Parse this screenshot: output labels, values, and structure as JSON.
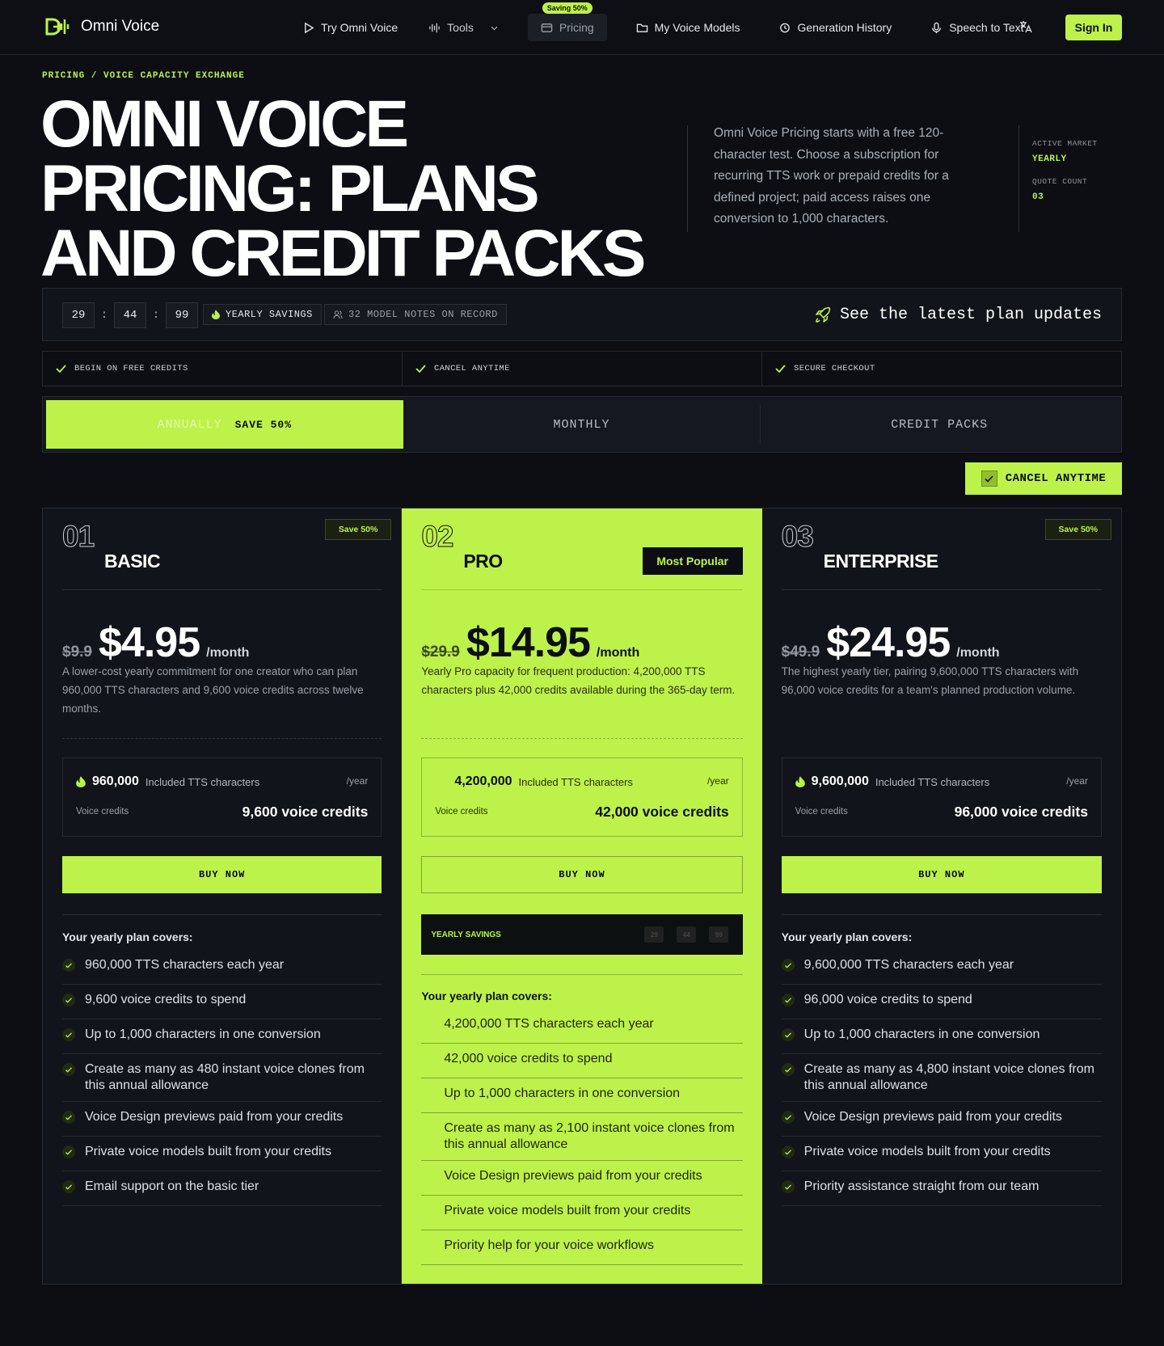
{
  "nav": {
    "logo_text": "Omni Voice",
    "items": [
      {
        "label": "Try Omni Voice",
        "icon": "play-icon"
      },
      {
        "label": "Tools",
        "icon": "waveform-icon"
      },
      {
        "label": "Pricing",
        "icon": "card-icon",
        "badge": "Saving 50%"
      },
      {
        "label": "My Voice Models",
        "icon": "folder-icon"
      },
      {
        "label": "Generation History",
        "icon": "history-icon"
      },
      {
        "label": "Speech to Text",
        "icon": "mic-icon"
      }
    ],
    "signin": "Sign In"
  },
  "hero": {
    "breadcrumb": "PRICING / VOICE CAPACITY EXCHANGE",
    "title": "OMNI VOICE PRICING: PLANS AND CREDIT PACKS",
    "description": "Omni Voice Pricing starts with a free 120-character test. Choose a subscription for recurring TTS work or prepaid credits for a defined project; paid access raises one conversion to 1,000 characters.",
    "market_label": "ACTIVE MARKET",
    "market_value": "YEARLY",
    "quote_label": "QUOTE COUNT",
    "quote_value": "03"
  },
  "stats": {
    "timer": [
      "29",
      "44",
      "99"
    ],
    "savings": "YEARLY SAVINGS",
    "notes": "32 MODEL NOTES ON RECORD",
    "latest": "See the latest plan updates"
  },
  "benefits": [
    "BEGIN ON FREE CREDITS",
    "CANCEL ANYTIME",
    "SECURE CHECKOUT"
  ],
  "tabs": {
    "annually": "ANNUALLY",
    "annually_save": "SAVE 50%",
    "monthly": "MONTHLY",
    "credit": "CREDIT PACKS"
  },
  "cancel_anytime": "CANCEL ANYTIME",
  "plans": [
    {
      "num": "01",
      "name": "BASIC",
      "save": "Save 50%",
      "old": "$9.9",
      "price": "$4.95",
      "per": "/month",
      "desc": "A lower-cost yearly commitment for one creator who can plan 960,000 TTS characters and 9,600 voice credits across twelve months.",
      "tts": "960,000",
      "tts_label": "Included TTS characters",
      "year": "/year",
      "vc_label": "Voice credits",
      "vc": "9,600 voice credits",
      "buy": "BUY NOW",
      "covers": "Your yearly plan covers:",
      "features": [
        "960,000 TTS characters each year",
        "9,600 voice credits to spend",
        "Up to 1,000 characters in one conversion",
        "Create as many as 480 instant voice clones from this annual allowance",
        "Voice Design previews paid from your credits",
        "Private voice models built from your credits",
        "Email support on the basic tier"
      ]
    },
    {
      "num": "02",
      "name": "PRO",
      "popular": "Most Popular",
      "old": "$29.9",
      "price": "$14.95",
      "per": "/month",
      "desc": "Yearly Pro capacity for frequent production: 4,200,000 TTS characters plus 42,000 credits available during the 365-day term.",
      "tts": "4,200,000",
      "tts_label": "Included TTS characters",
      "year": "/year",
      "vc_label": "Voice credits",
      "vc": "42,000 voice credits",
      "buy": "BUY NOW",
      "savings": "YEARLY SAVINGS",
      "covers": "Your yearly plan covers:",
      "features": [
        "4,200,000 TTS characters each year",
        "42,000 voice credits to spend",
        "Up to 1,000 characters in one conversion",
        "Create as many as 2,100 instant voice clones from this annual allowance",
        "Voice Design previews paid from your credits",
        "Private voice models built from your credits",
        "Priority help for your voice workflows"
      ]
    },
    {
      "num": "03",
      "name": "ENTERPRISE",
      "save": "Save 50%",
      "old": "$49.9",
      "price": "$24.95",
      "per": "/month",
      "desc": "The highest yearly tier, pairing 9,600,000 TTS characters with 96,000 voice credits for a team's planned production volume.",
      "tts": "9,600,000",
      "tts_label": "Included TTS characters",
      "year": "/year",
      "vc_label": "Voice credits",
      "vc": "96,000 voice credits",
      "buy": "BUY NOW",
      "covers": "Your yearly plan covers:",
      "features": [
        "9,600,000 TTS characters each year",
        "96,000 voice credits to spend",
        "Up to 1,000 characters in one conversion",
        "Create as many as 4,800 instant voice clones from this annual allowance",
        "Voice Design previews paid from your credits",
        "Private voice models built from your credits",
        "Priority assistance straight from our team"
      ]
    }
  ],
  "colors": {
    "accent": "#bdf24a",
    "background": "#0c0e13"
  }
}
